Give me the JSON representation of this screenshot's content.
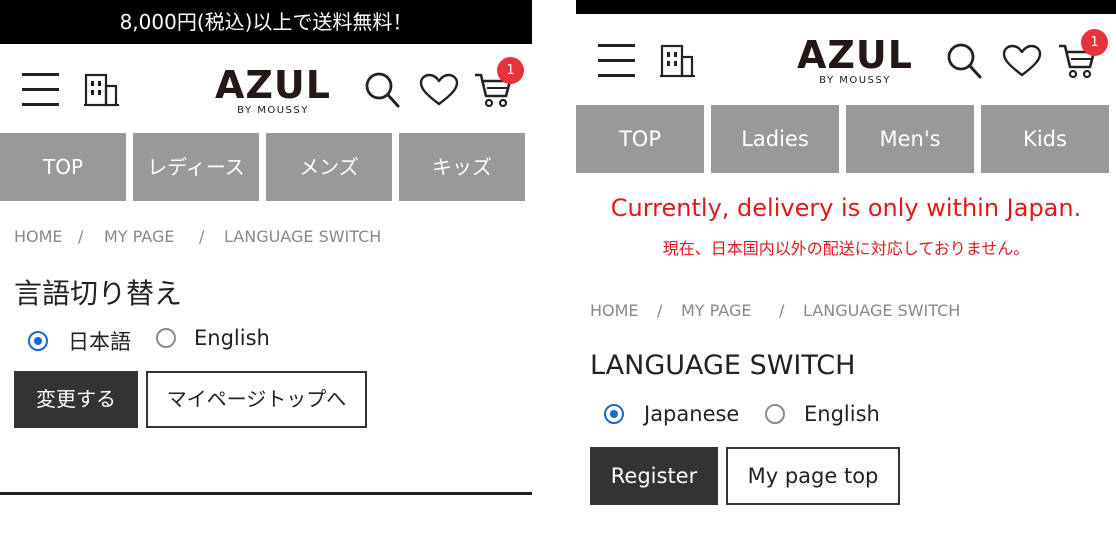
{
  "left": {
    "promo_text": "8,000円(税込)以上で送料無料！",
    "logo": {
      "main": "AZUL",
      "sub": "BY MOUSSY"
    },
    "cart_badge": "1",
    "nav_tabs": [
      "TOP",
      "レディース",
      "メンズ",
      "キッズ"
    ],
    "breadcrumb": [
      "HOME",
      "/",
      "MY PAGE",
      "/",
      "LANGUAGE SWITCH"
    ],
    "heading": "言語切り替え",
    "radio_options": [
      {
        "label": "日本語",
        "checked": true
      },
      {
        "label": "English",
        "checked": false
      }
    ],
    "buttons": {
      "submit": "変更する",
      "mypage": "マイページトップへ"
    }
  },
  "right": {
    "logo": {
      "main": "AZUL",
      "sub": "BY MOUSSY"
    },
    "cart_badge": "1",
    "nav_tabs": [
      "TOP",
      "Ladies",
      "Men's",
      "Kids"
    ],
    "notice_en": "Currently, delivery is only within Japan.",
    "notice_ja": "現在、日本国内以外の配送に対応しておりません。",
    "breadcrumb": [
      "HOME",
      "/",
      "MY PAGE",
      "/",
      "LANGUAGE SWITCH"
    ],
    "heading": "LANGUAGE SWITCH",
    "radio_options": [
      {
        "label": "Japanese",
        "checked": true
      },
      {
        "label": "English",
        "checked": false
      }
    ],
    "buttons": {
      "submit": "Register",
      "mypage": "My page top"
    }
  },
  "colors": {
    "nav_tab_bg": "#999999",
    "notice_red": "#e0191a",
    "badge_red": "#e8333c",
    "radio_blue": "#1c64d9",
    "dark_button": "#333333"
  },
  "icons": [
    "hamburger-menu-icon",
    "store-building-icon",
    "search-icon",
    "heart-icon",
    "cart-icon"
  ]
}
